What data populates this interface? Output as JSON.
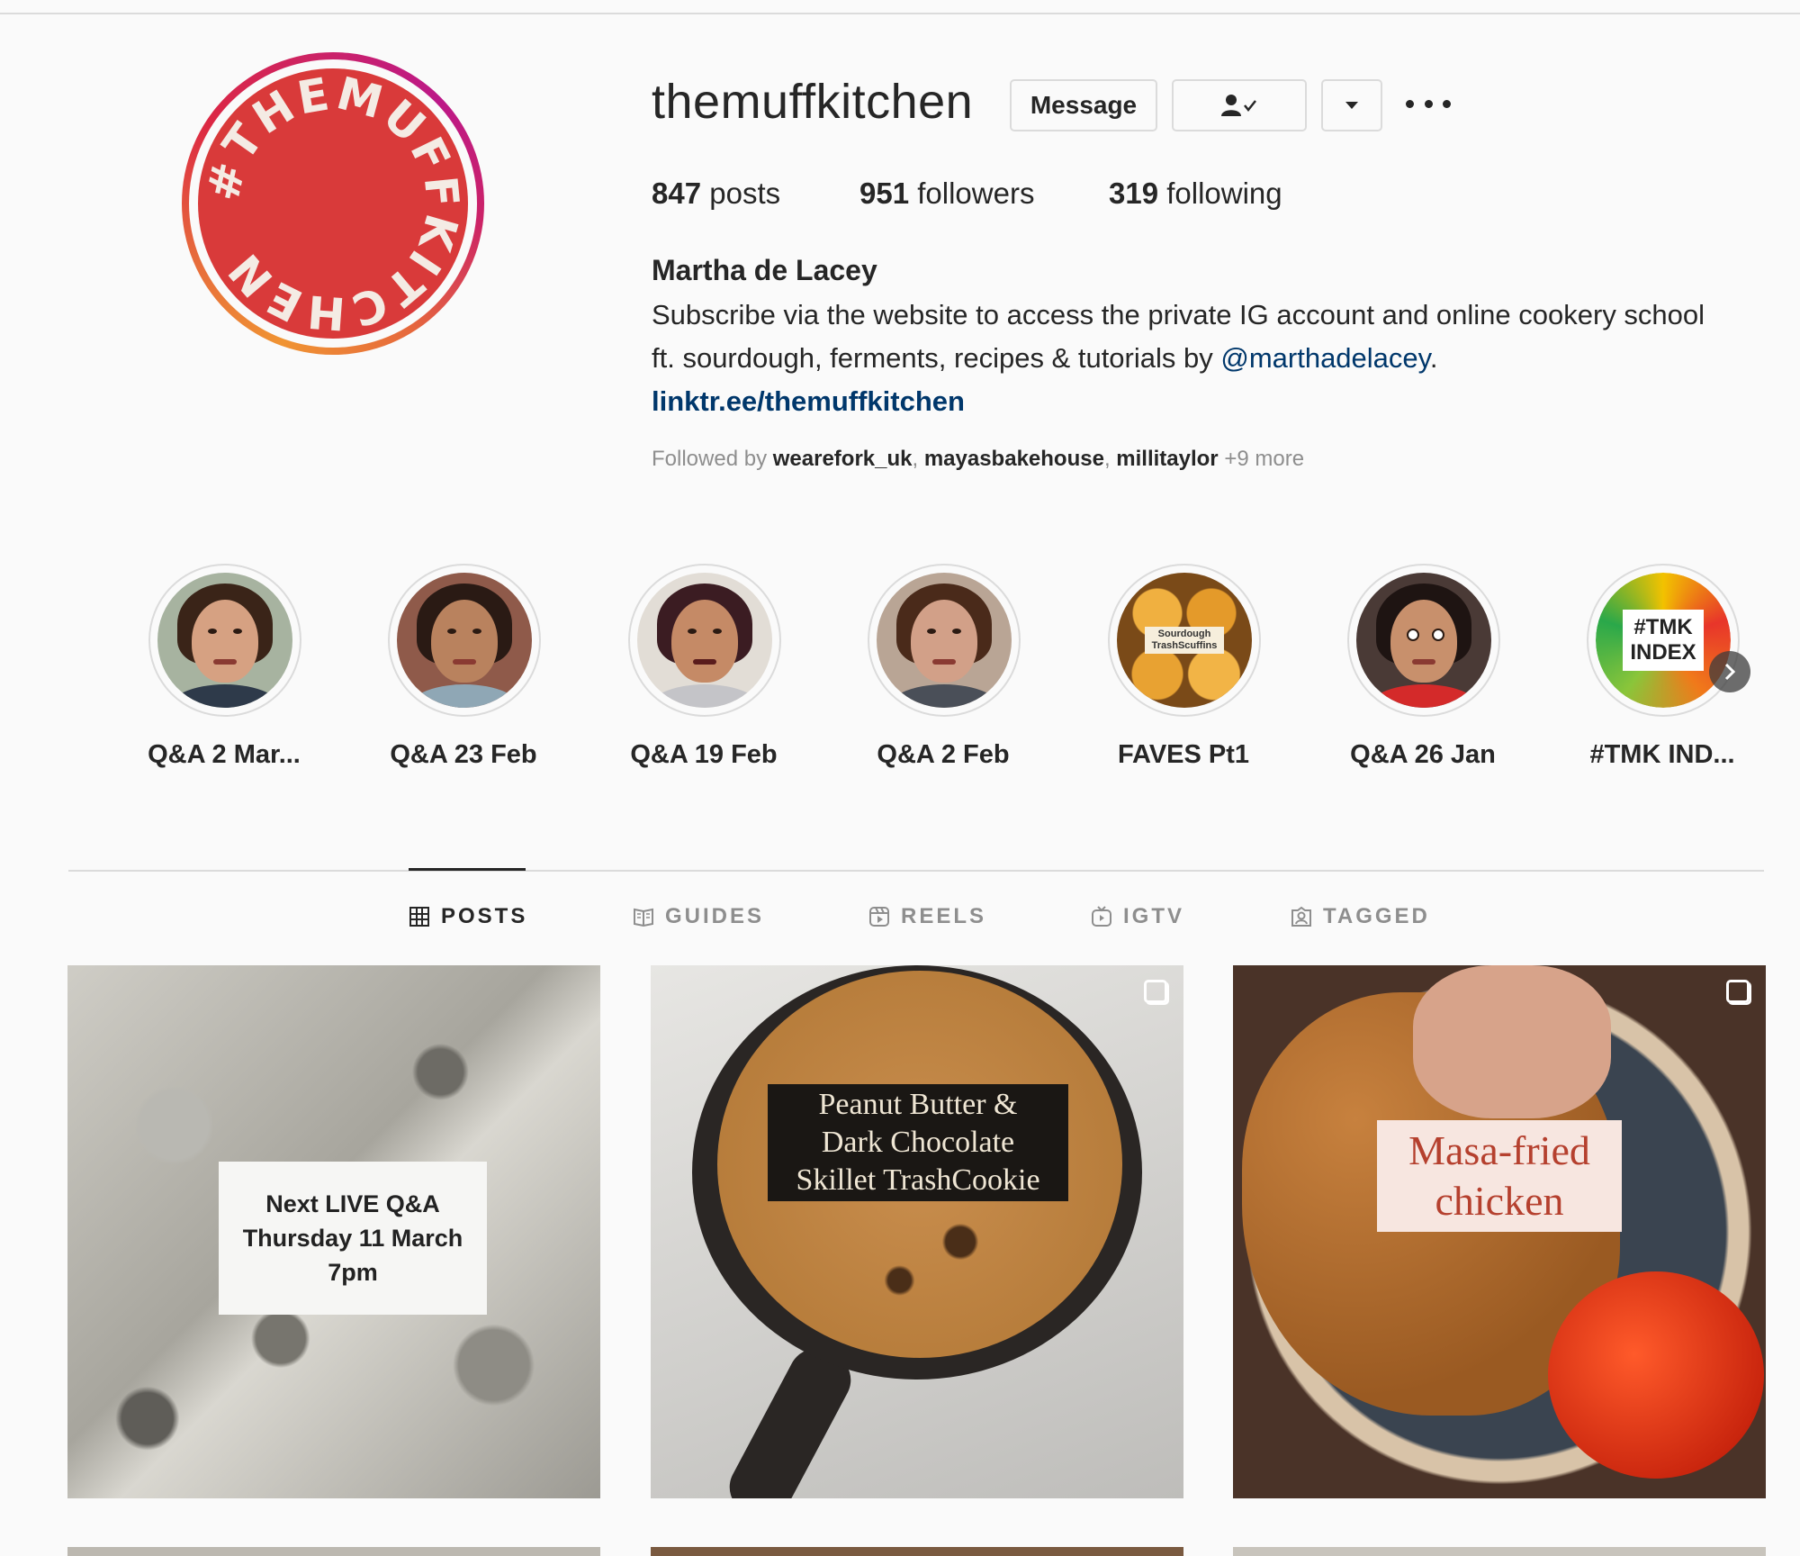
{
  "profile": {
    "username": "themuffkitchen",
    "avatar_text": "#THEMUFFKITCHEN",
    "message_label": "Message",
    "stats": {
      "posts_count": "847",
      "posts_label": "posts",
      "followers_count": "951",
      "followers_label": "followers",
      "following_count": "319",
      "following_label": "following"
    },
    "full_name": "Martha de Lacey",
    "bio_text": "Subscribe via the website to access the private IG account and online cookery school ft. sourdough, ferments, recipes & tutorials by ",
    "bio_mention": "@marthadelacey",
    "bio_end": ".",
    "link": "linktr.ee/themuffkitchen",
    "followed_by_prefix": "Followed by",
    "followed_by_names": [
      "wearefork_uk",
      "mayasbakehouse",
      "millitaylor"
    ],
    "followed_by_more": "+9 more"
  },
  "icons": {
    "follow_status": "person-check-icon",
    "dropdown": "caret-down-icon",
    "more": "more-options-icon",
    "next": "chevron-right-icon"
  },
  "highlights": [
    {
      "label": "Q&A 2 Mar..."
    },
    {
      "label": "Q&A 23 Feb"
    },
    {
      "label": "Q&A 19 Feb"
    },
    {
      "label": "Q&A 2 Feb"
    },
    {
      "label": "FAVES Pt1",
      "cover_text": "Sourdough TrashScuffins"
    },
    {
      "label": "Q&A 26 Jan"
    },
    {
      "label": "#TMK IND...",
      "cover_text_1": "#TMK",
      "cover_text_2": "INDEX"
    }
  ],
  "tabs": [
    {
      "label": "POSTS",
      "icon": "grid-icon",
      "active": true
    },
    {
      "label": "GUIDES",
      "icon": "guides-icon"
    },
    {
      "label": "REELS",
      "icon": "reels-icon"
    },
    {
      "label": "IGTV",
      "icon": "igtv-icon"
    },
    {
      "label": "TAGGED",
      "icon": "tagged-icon"
    }
  ],
  "posts": [
    {
      "overlay_line1": "Next LIVE Q&A",
      "overlay_line2": "Thursday 11 March",
      "overlay_line3": "7pm"
    },
    {
      "overlay_line1": "Peanut Butter &",
      "overlay_line2": "Dark Chocolate",
      "overlay_line3": "Skillet TrashCookie"
    },
    {
      "overlay_line1": "Masa-fried",
      "overlay_line2": "chicken"
    }
  ],
  "colors": {
    "link": "#00376b",
    "text": "#262626",
    "muted": "#8e8e8e",
    "border": "#dbdbdb",
    "avatar_red": "#d93a3a"
  }
}
